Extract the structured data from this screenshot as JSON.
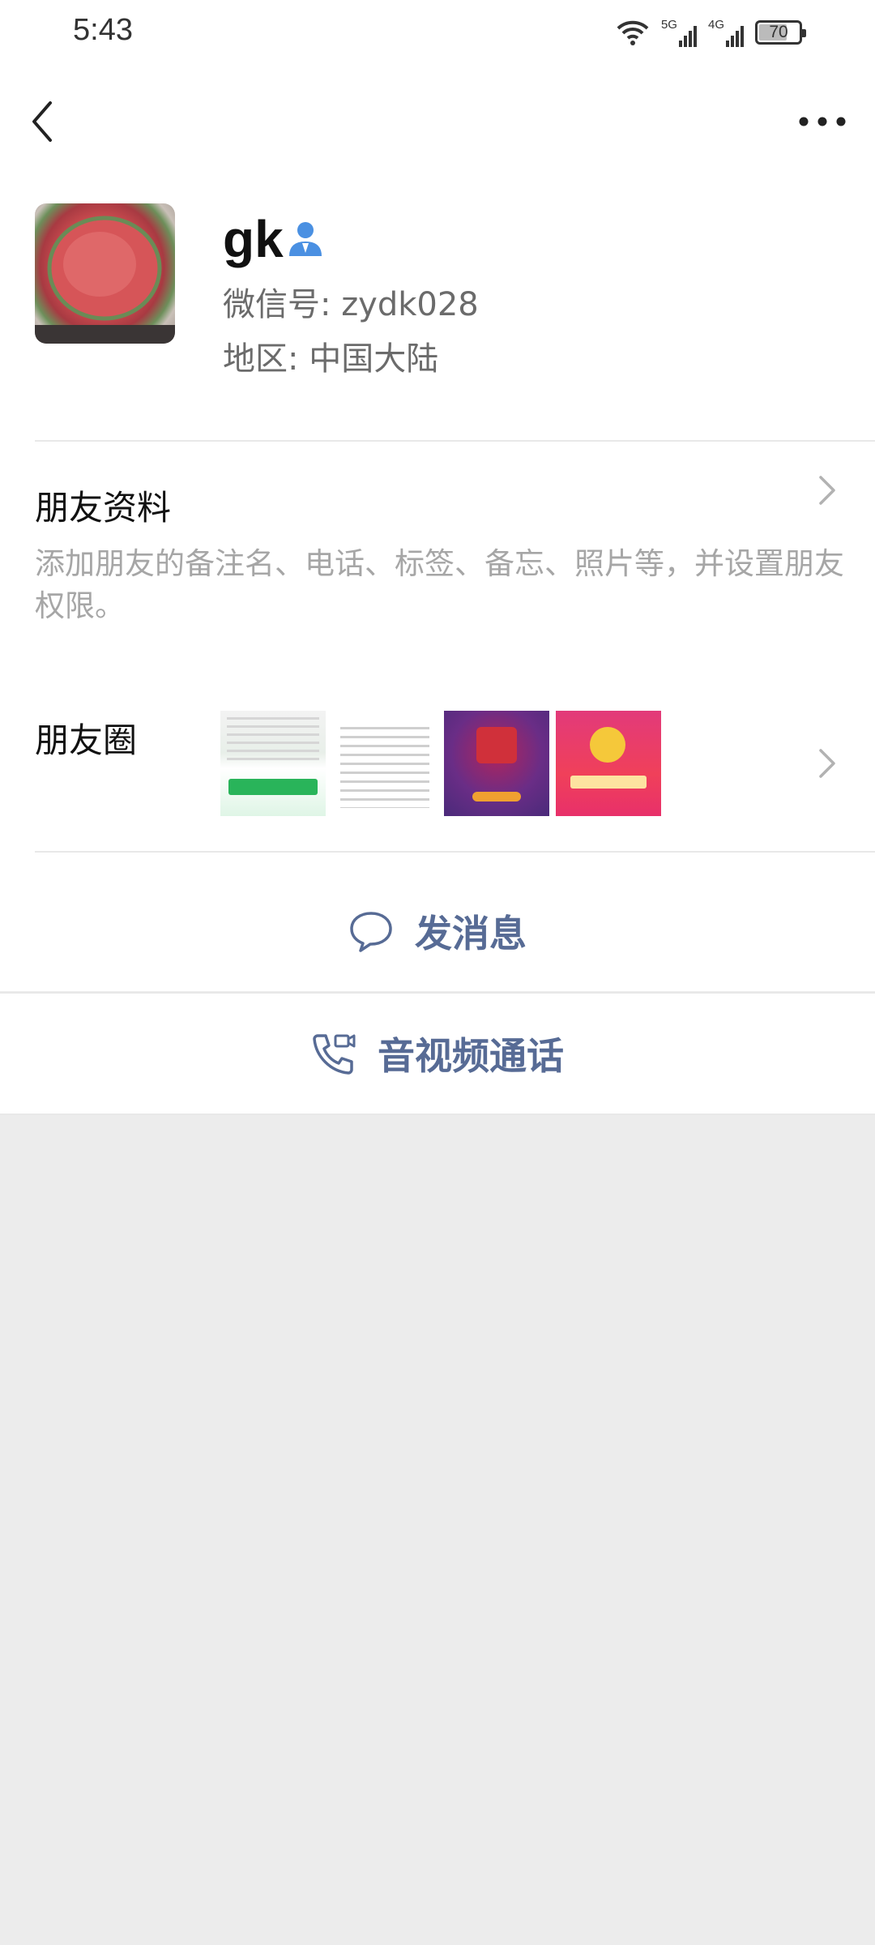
{
  "status_bar": {
    "time": "5:43",
    "network_1": "5G",
    "network_2": "4G",
    "battery": "70",
    "battery_level_percent": 70
  },
  "nav": {
    "back_icon": "chevron-left-icon",
    "more_icon": "ellipsis-icon"
  },
  "profile": {
    "name": "gk",
    "wechat_id": "微信号: zydk028",
    "region": "地区: 中国大陆"
  },
  "friend_info": {
    "title": "朋友资料",
    "description": "添加朋友的备注名、电话、标签、备忘、照片等，并设置朋友权限。"
  },
  "moments": {
    "title": "朋友圈"
  },
  "actions": {
    "message_label": "发消息",
    "call_label": "音视频通话"
  },
  "colors": {
    "link": "#576b95",
    "background": "#ececec",
    "muted_text": "#a6a6a6"
  }
}
